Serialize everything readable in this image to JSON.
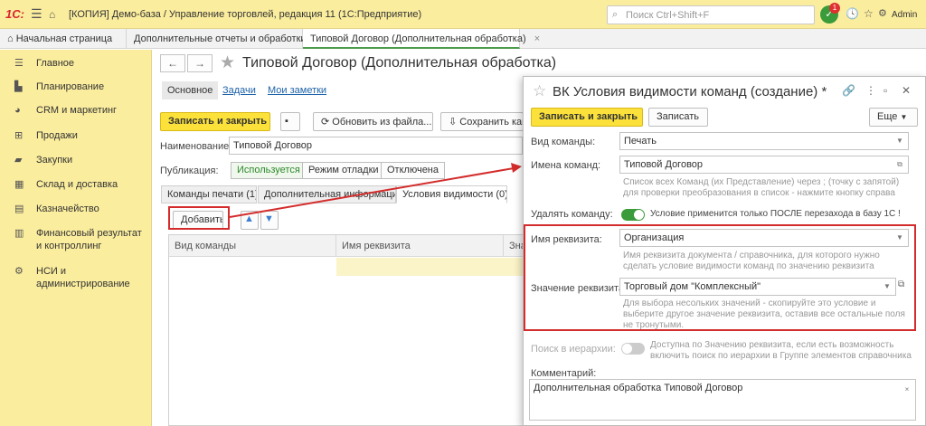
{
  "titlebar": {
    "logo": "1С:",
    "title": "[КОПИЯ] Демо-база / Управление торговлей, редакция 11  (1С:Предприятие)",
    "search_placeholder": "Поиск Ctrl+Shift+F",
    "notif_count": "1",
    "user": "Admin"
  },
  "tabs": [
    {
      "label": "Начальная страница"
    },
    {
      "label": "Дополнительные отчеты и обработки"
    },
    {
      "label": "Типовой Договор (Дополнительная обработка)"
    }
  ],
  "sidebar": {
    "items": [
      {
        "label": "Главное"
      },
      {
        "label": "Планирование"
      },
      {
        "label": "CRM и маркетинг"
      },
      {
        "label": "Продажи"
      },
      {
        "label": "Закупки"
      },
      {
        "label": "Склад и доставка"
      },
      {
        "label": "Казначейство"
      },
      {
        "label": "Финансовый результат и контроллинг"
      },
      {
        "label": "НСИ и администрирование"
      }
    ]
  },
  "form": {
    "title": "Типовой Договор (Дополнительная обработка)",
    "nav": {
      "main": "Основное",
      "tasks": "Задачи",
      "notes": "Мои заметки"
    },
    "toolbar": {
      "save_close": "Записать и закрыть",
      "refresh": "Обновить из файла...",
      "save_to": "Сохранить как"
    },
    "name_label": "Наименование:",
    "name_value": "Типовой Договор",
    "pub_label": "Публикация:",
    "pub_options": [
      "Используется",
      "Режим отладки",
      "Отключена"
    ],
    "inner_tabs": [
      "Команды печати (1)",
      "Дополнительная информация",
      "Условия видимости (0)"
    ],
    "add_button": "Добавить",
    "columns": [
      "Вид команды",
      "Имя реквизита",
      "Зна"
    ]
  },
  "dialog": {
    "title": "ВК Условия видимости команд (создание) *",
    "save_close": "Записать и закрыть",
    "save": "Записать",
    "more": "Еще",
    "kind_label": "Вид команды:",
    "kind_value": "Печать",
    "names_label": "Имена команд:",
    "names_value": "Типовой Договор",
    "names_hint_1": "Список всех Команд (их Представление) через ; (точку с запятой)",
    "names_hint_2": "для проверки преобразования в список - нажмите кнопку справа",
    "delete_label": "Удалять команду:",
    "delete_hint": "Условие применится  только ПОСЛЕ перезахода в базу 1С !",
    "attr_label": "Имя реквизита:",
    "attr_value": "Организация",
    "attr_hint_1": "Имя реквизита документа / справочника, для которого нужно",
    "attr_hint_2": "сделать условие видимости команд по значению реквизита",
    "val_label": "Значение реквизита:",
    "val_value": "Торговый дом \"Комплексный\"",
    "val_hint_1": "Для выбора несольких значений - скопируйте это условие и",
    "val_hint_2": "выберите другое значение реквизита, оставив все остальные поля",
    "val_hint_3": "не тронутыми.",
    "hier_label": "Поиск в иерархии:",
    "hier_hint_1": "Доступна по Значению реквизита, если есть возможность",
    "hier_hint_2": "включить поиск по иерархии в Группе элементов справочника",
    "comment_label": "Комментарий:",
    "comment_value": "Дополнительная обработка Типовой Договор"
  },
  "colors": {
    "accent_yellow": "#fbe13a",
    "sidebar": "#fbed9e",
    "toggle_on": "#3a9b3a",
    "highlight_red": "#d42c2c"
  }
}
